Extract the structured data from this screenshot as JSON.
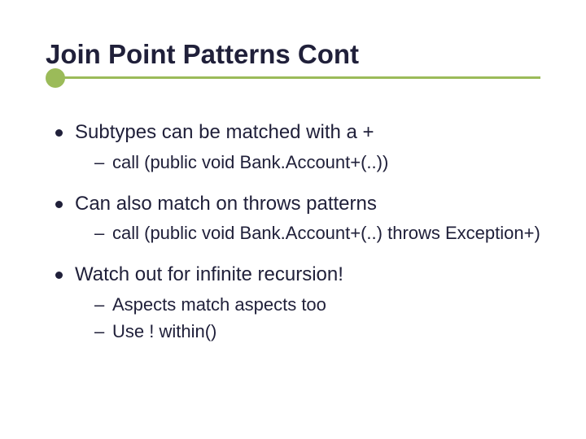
{
  "title": "Join Point Patterns Cont",
  "bullets": [
    {
      "text": "Subtypes can be matched with a +",
      "sub": [
        "call (public void Bank.Account+(..))"
      ]
    },
    {
      "text": "Can also match on throws patterns",
      "sub": [
        "call (public void Bank.Account+(..) throws Exception+)"
      ]
    },
    {
      "text": "Watch out for infinite recursion!",
      "sub": [
        "Aspects match aspects too",
        "Use ! within()"
      ]
    }
  ]
}
